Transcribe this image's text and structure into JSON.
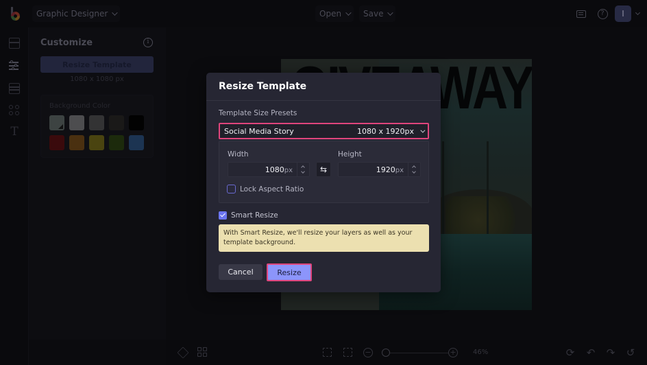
{
  "topbar": {
    "app_name": "Graphic Designer",
    "open_label": "Open",
    "save_label": "Save",
    "avatar_initial": "I"
  },
  "sidebar": {
    "rail_icons": [
      "layout-icon",
      "sliders-icon",
      "background-icon",
      "graphics-icon",
      "text-icon"
    ],
    "panel_title": "Customize",
    "resize_template_label": "Resize Template",
    "template_size": "1080 x 1080 px",
    "background_color_label": "Background Color",
    "swatches": [
      "#3d4342",
      "#4d4d4f",
      "#333334",
      "#1a1918",
      "#020202",
      "#3a0a0c",
      "#4a3010",
      "#4a4410",
      "#1c2a0c",
      "#1c3452"
    ]
  },
  "canvas": {
    "headline": "GIVEAWAY"
  },
  "bottombar": {
    "zoom_level": "46%",
    "zoom_value_percent": 46
  },
  "modal": {
    "title": "Resize Template",
    "presets_label": "Template Size Presets",
    "preset_name": "Social Media Story",
    "preset_dims": "1080 x 1920px",
    "width_label": "Width",
    "width_value": "1080",
    "height_label": "Height",
    "height_value": "1920",
    "unit": "px",
    "lock_label": "Lock Aspect Ratio",
    "lock_checked": false,
    "smart_label": "Smart Resize",
    "smart_checked": true,
    "note": "With Smart Resize, we'll resize your layers as well as your template background.",
    "cancel_label": "Cancel",
    "resize_label": "Resize",
    "highlight_color": "#e0457c",
    "accent_color": "#8c95fb"
  }
}
